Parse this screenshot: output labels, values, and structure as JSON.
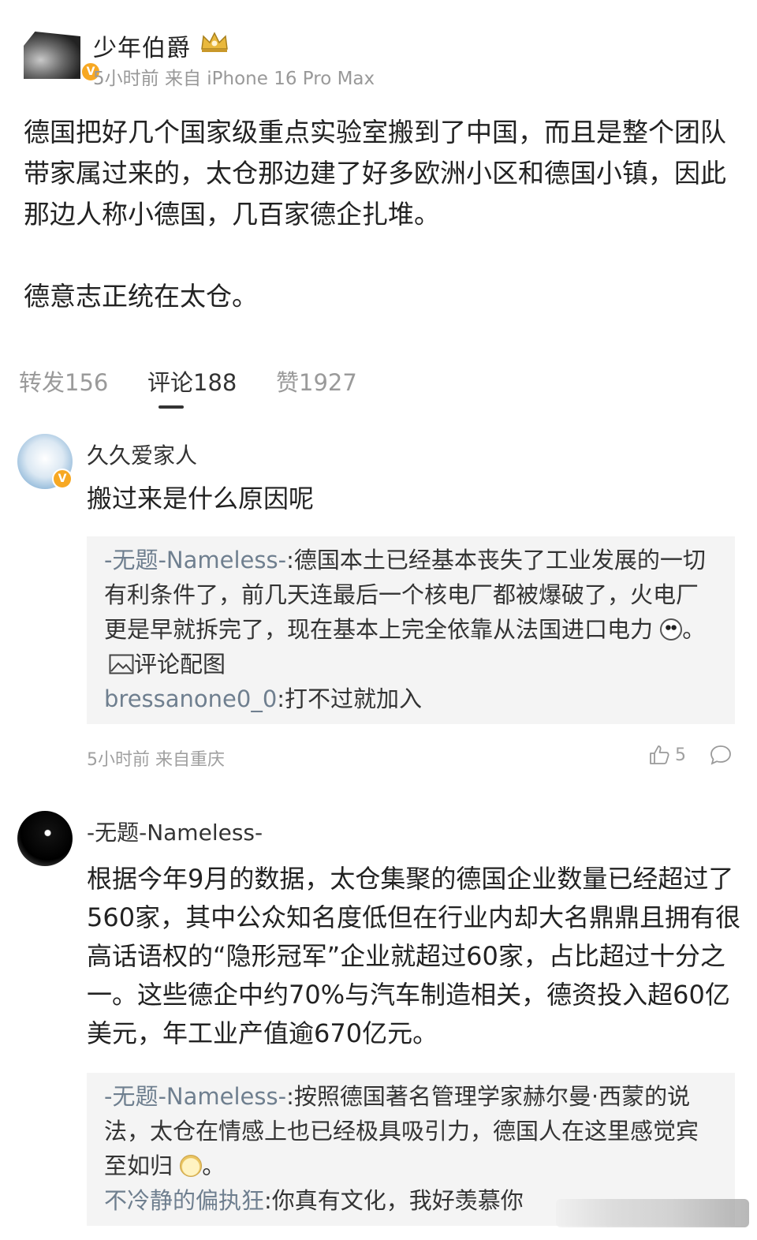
{
  "post": {
    "author": "少年伯爵",
    "meta": "5小时前 来自 iPhone 16 Pro Max",
    "paragraphs": [
      "德国把好几个国家级重点实验室搬到了中国，而且是整个团队带家属过来的，太仓那边建了好多欧洲小区和德国小镇，因此那边人称小德国，几百家德企扎堆。",
      "德意志正统在太仓。"
    ]
  },
  "tabs": {
    "repost": "转发156",
    "comment": "评论188",
    "like": "赞1927",
    "active": "comment"
  },
  "comments": [
    {
      "author": "久久爱家人",
      "text": "搬过来是什么原因呢",
      "replies": [
        {
          "user": "-无题-Nameless-",
          "text": ":德国本土已经基本丧失了工业发展的一切有利条件了，前几天连最后一个核电厂都被爆破了，火电厂更是早就拆完了，现在基本上完全依靠从法国进口电力",
          "suffix": "。",
          "attachment": "评论配图"
        },
        {
          "user": "bressanone0_0",
          "text": ":打不过就加入"
        }
      ],
      "meta": "5小时前 来自重庆",
      "likes": "5"
    },
    {
      "author": "-无题-Nameless-",
      "text": "根据今年9月的数据，太仓集聚的德国企业数量已经超过了560家，其中公众知名度低但在行业内却大名鼎鼎且拥有很高话语权的“隐形冠军”企业就超过60家，占比超过十分之一。这些德企中约70%与汽车制造相关，德资投入超60亿美元，年工业产值逾670亿元。",
      "replies": [
        {
          "user": "-无题-Nameless-",
          "text": ":按照德国著名管理学家赫尔曼·西蒙的说法，太仓在情感上也已经极具吸引力，德国人在这里感觉宾至如归",
          "suffix": "。"
        },
        {
          "user": "不冷静的偏执狂",
          "text": ":你真有文化，我好羡慕你"
        }
      ]
    }
  ],
  "icons": {
    "verified": "verified-badge-icon",
    "crown": "crown-icon",
    "like": "thumbs-up-icon",
    "comment": "comment-bubble-icon",
    "image": "image-icon"
  },
  "colors": {
    "badge": "#f7a823",
    "reply_bg": "#f4f4f4",
    "muted": "#999999"
  }
}
